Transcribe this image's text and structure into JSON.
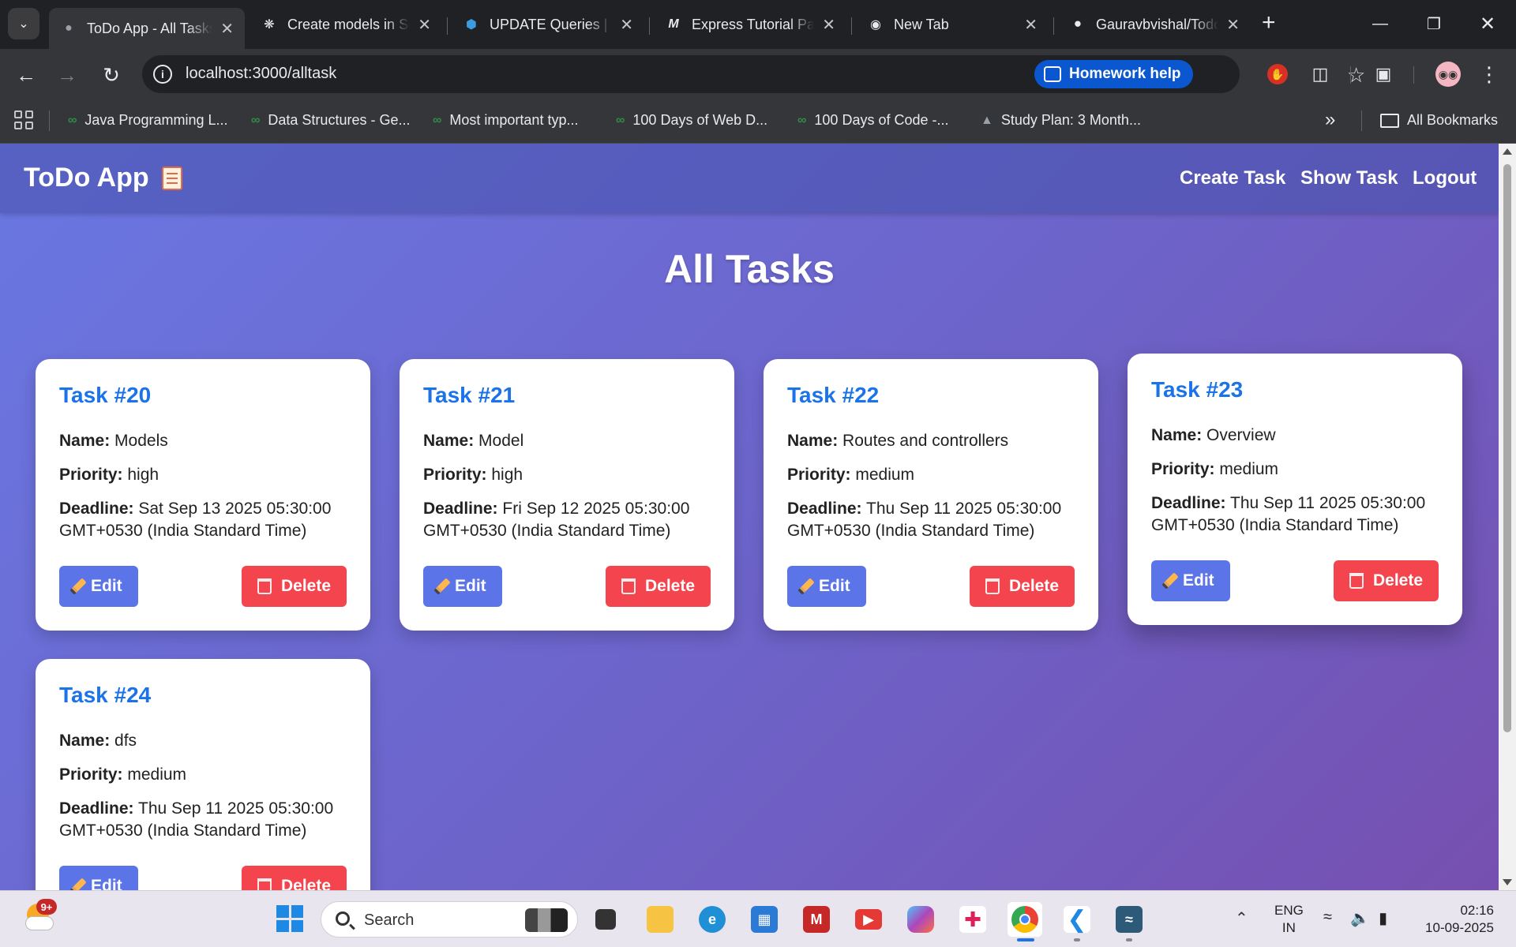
{
  "browser": {
    "tabs": [
      {
        "label": "ToDo App - All Tasks",
        "active": true
      },
      {
        "label": "Create models in Sequelize",
        "active": false
      },
      {
        "label": "UPDATE Queries | Sequelize",
        "active": false
      },
      {
        "label": "Express Tutorial Part",
        "active": false
      },
      {
        "label": "New Tab",
        "active": false
      },
      {
        "label": "Gauravbvishal/TodoApp",
        "active": false
      }
    ],
    "url": "localhost:3000/alltask",
    "homework_help": "Homework help",
    "bookmarks": [
      "Java Programming L...",
      "Data Structures - Ge...",
      "Most important typ...",
      "100 Days of Web D...",
      "100 Days of Code -...",
      "Study Plan: 3 Month..."
    ],
    "all_bookmarks": "All Bookmarks"
  },
  "app": {
    "brand": "ToDo App",
    "nav": {
      "create": "Create Task",
      "show": "Show Task",
      "logout": "Logout"
    },
    "page_title": "All Tasks",
    "labels": {
      "name": "Name:",
      "priority": "Priority:",
      "deadline": "Deadline:",
      "edit": "Edit",
      "delete": "Delete"
    },
    "tasks": [
      {
        "title": "Task #20",
        "name": "Models",
        "priority": "high",
        "deadline": "Sat Sep 13 2025 05:30:00 GMT+0530 (India Standard Time)"
      },
      {
        "title": "Task #21",
        "name": "Model",
        "priority": "high",
        "deadline": "Fri Sep 12 2025 05:30:00 GMT+0530 (India Standard Time)"
      },
      {
        "title": "Task #22",
        "name": "Routes and controllers",
        "priority": "medium",
        "deadline": "Thu Sep 11 2025 05:30:00 GMT+0530 (India Standard Time)"
      },
      {
        "title": "Task #23",
        "name": "Overview",
        "priority": "medium",
        "deadline": "Thu Sep 11 2025 05:30:00 GMT+0530 (India Standard Time)"
      },
      {
        "title": "Task #24",
        "name": "dfs",
        "priority": "medium",
        "deadline": "Thu Sep 11 2025 05:30:00 GMT+0530 (India Standard Time)"
      }
    ],
    "colors": {
      "title": "#1a73e8",
      "edit": "#5b74e8",
      "delete": "#f4444e"
    }
  },
  "taskbar": {
    "weather_badge": "9+",
    "search_placeholder": "Search",
    "language": [
      "ENG",
      "IN"
    ],
    "time": "02:16",
    "date": "10-09-2025"
  }
}
